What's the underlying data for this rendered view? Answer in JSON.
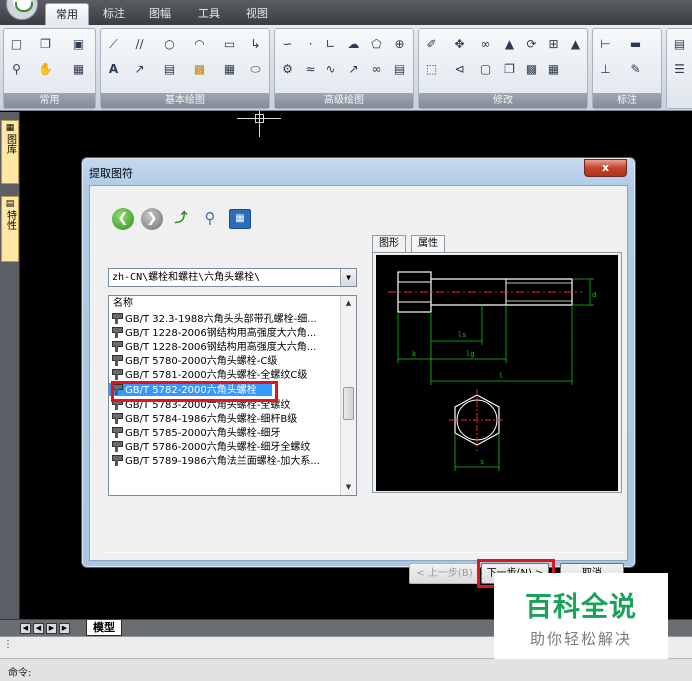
{
  "ribbon": {
    "tabs": [
      "常用",
      "标注",
      "图幅",
      "工具",
      "视图"
    ],
    "active_tab": "常用",
    "panels": [
      {
        "label": "常用",
        "icons": [
          "new-file-icon",
          "copy-icon",
          "save-icon",
          "zoom-icon",
          "pan-icon",
          "layer-icon"
        ]
      },
      {
        "label": "基本绘图",
        "icons": [
          "line-icon",
          "parallel-line-icon",
          "circle-icon",
          "arc-icon",
          "rectangle-icon",
          "polyline-icon",
          "text-icon",
          "ray-icon",
          "hatch-icon",
          "color-fill-icon",
          "table-icon",
          "ellipse-icon"
        ]
      },
      {
        "label": "高级绘图",
        "icons": [
          "spline-icon",
          "point-icon",
          "angle-line-icon",
          "cloud-icon",
          "polygon-icon",
          "center-mark-icon",
          "gear-icon",
          "wave-icon",
          "break-icon",
          "dimension-arrow-icon",
          "spring-icon",
          "keyway-icon"
        ]
      },
      {
        "label": "修改",
        "icons": [
          "erase-icon",
          "move-icon",
          "offset-icon",
          "mirror-icon",
          "rotate-icon",
          "array-icon",
          "scale-icon",
          "select-icon",
          "trim-icon",
          "stretch-icon",
          "copy-object-icon",
          "explode-icon"
        ]
      },
      {
        "label": "标注",
        "icons": [
          "linear-dim-icon",
          "dim-style-icon",
          "tolerance-icon",
          "annotation-icon"
        ]
      }
    ]
  },
  "left_dock": {
    "tab1": "图库",
    "tab2": "特性"
  },
  "dialog": {
    "title": "提取图符",
    "close_glyph": "x",
    "path": "zh-CN\\螺栓和螺柱\\六角头螺栓\\",
    "list_header": "名称",
    "items": [
      "GB/T 32.3-1988六角头头部带孔螺栓-细...",
      "GB/T 1228-2006钢结构用高强度大六角...",
      "GB/T 1228-2006钢结构用高强度大六角...",
      "GB/T 5780-2000六角头螺栓-C级",
      "GB/T 5781-2000六角头螺栓-全螺纹C级",
      "GB/T 5782-2000六角头螺栓",
      "GB/T 5783-2000六角头螺栓-全螺纹",
      "GB/T 5784-1986六角头螺栓-细杆B级",
      "GB/T 5785-2000六角头螺栓-细牙",
      "GB/T 5786-2000六角头螺栓-细牙全螺纹",
      "GB/T 5789-1986六角法兰面螺栓-加大系..."
    ],
    "selected_index": 5,
    "tabs": {
      "graphic": "图形",
      "properties": "属性"
    },
    "drawing_labels": {
      "d": "d",
      "ls": "ls",
      "k": "k",
      "lg": "lg",
      "l": "l",
      "s": "s"
    },
    "buttons": {
      "back": "< 上一步(B)",
      "next": "下一步(N) >",
      "cancel": "取消"
    }
  },
  "layout_tabs": {
    "model": "模型"
  },
  "command": {
    "label": "命令:"
  },
  "watermark": {
    "title": "百科全说",
    "subtitle": "助你轻松解决"
  }
}
